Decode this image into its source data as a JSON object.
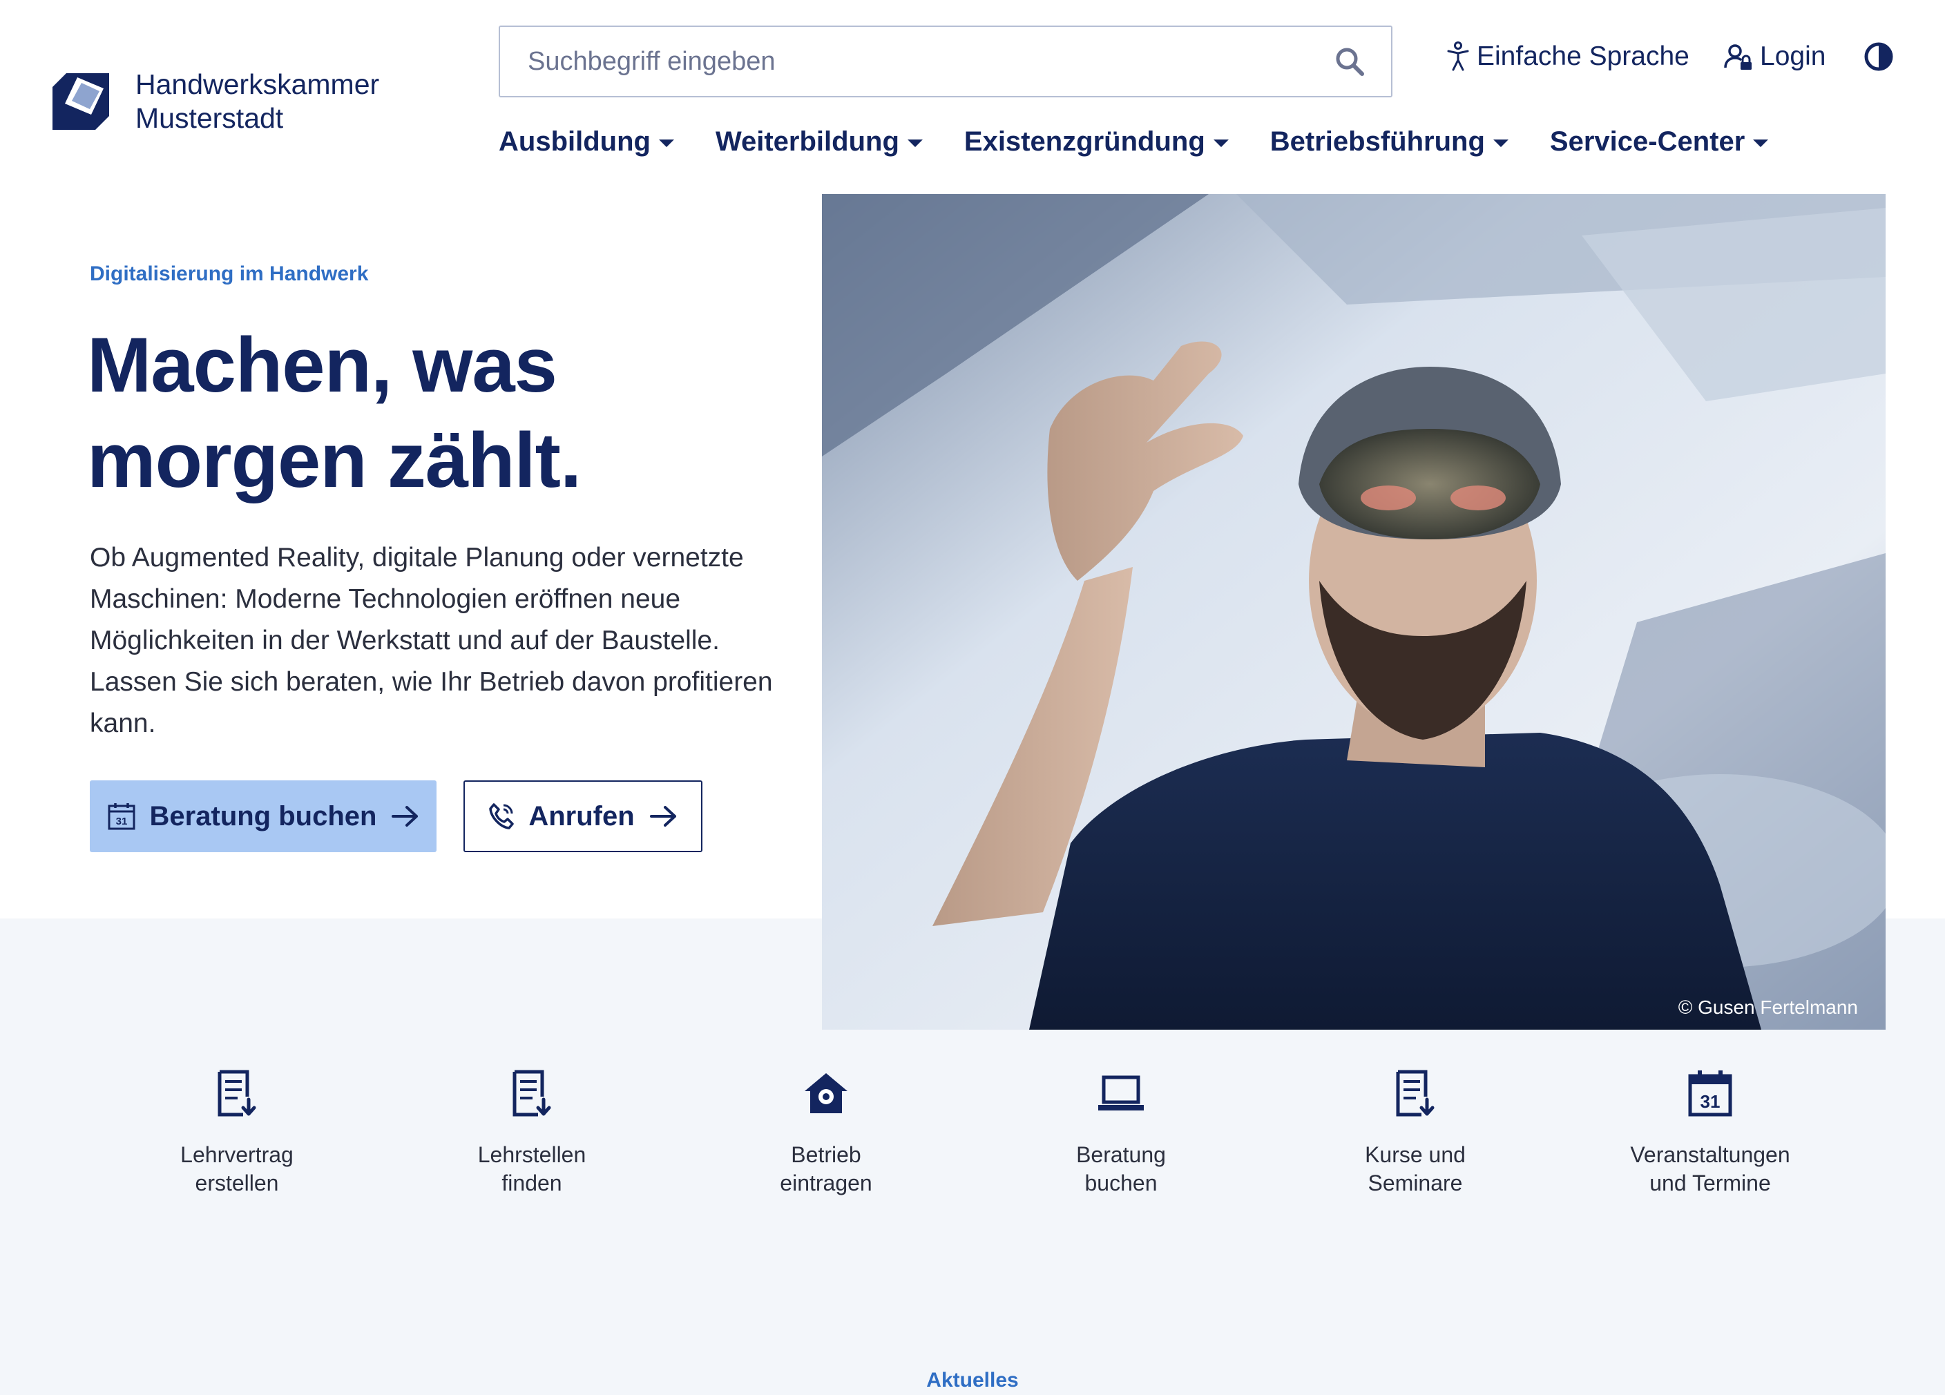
{
  "header": {
    "logo_line1": "Handwerkskammer",
    "logo_line2": "Musterstadt",
    "search_placeholder": "Suchbegriff eingeben",
    "utility": {
      "easy_language": "Einfache Sprache",
      "login": "Login"
    },
    "nav": [
      {
        "label": "Ausbildung"
      },
      {
        "label": "Weiterbildung"
      },
      {
        "label": "Existenzgründung"
      },
      {
        "label": "Betriebsführung"
      },
      {
        "label": "Service-Center"
      }
    ]
  },
  "hero": {
    "eyebrow": "Digitalisierung im Handwerk",
    "headline_line1": "Machen, was",
    "headline_line2": "morgen zählt.",
    "lead": "Ob Augmented Reality, digitale Planung oder vernetzte Maschinen: Moderne Technologien eröffnen neue Möglichkeiten in der Werkstatt und auf der Baustelle. Lassen Sie sich beraten, wie Ihr Betrieb davon profitieren kann.",
    "primary_button": "Beratung buchen",
    "secondary_button": "Anrufen",
    "calendar_day": "31",
    "photo_credit": "© Gusen Fertelmann"
  },
  "quick_links": [
    {
      "line1": "Lehrvertrag",
      "line2": "erstellen",
      "icon": "document-icon"
    },
    {
      "line1": "Lehrstellen",
      "line2": "finden",
      "icon": "document-icon"
    },
    {
      "line1": "Betrieb",
      "line2": "eintragen",
      "icon": "home-pin-icon"
    },
    {
      "line1": "Beratung",
      "line2": "buchen",
      "icon": "laptop-icon"
    },
    {
      "line1": "Kurse und",
      "line2": "Seminare",
      "icon": "document-icon"
    },
    {
      "line1": "Veranstaltungen",
      "line2": "und Termine",
      "icon": "calendar-icon"
    }
  ],
  "section_label": "Aktuelles",
  "colors": {
    "navy": "#13255f",
    "accent_blue": "#2f6ec4",
    "primary_button_bg": "#a9c8f3",
    "light_bg": "#f3f6fa"
  }
}
